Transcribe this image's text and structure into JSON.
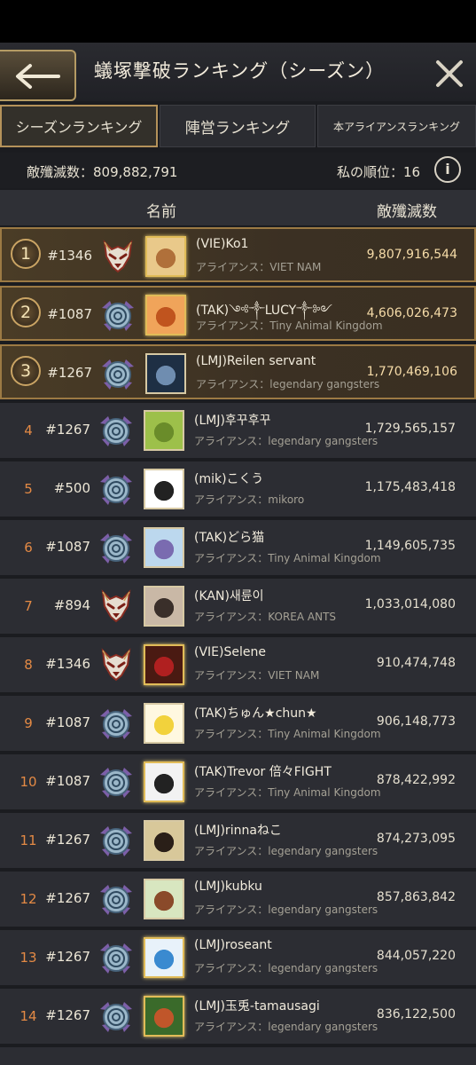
{
  "header": {
    "title": "蟻塚撃破ランキング（シーズン）"
  },
  "tabs": [
    {
      "label": "シーズンランキング",
      "active": true
    },
    {
      "label": "陣営ランキング",
      "active": false
    },
    {
      "label": "本アライアンスランキング",
      "active": false
    }
  ],
  "stats": {
    "kills_label": "敵殲滅数：",
    "kills_value": "809,882,791",
    "my_rank_label": "私の順位：",
    "my_rank_value": "16"
  },
  "columns": {
    "name": "名前",
    "score": "敵殲滅数"
  },
  "alliance_prefix": "アライアンス：",
  "rows": [
    {
      "rank": "1",
      "server": "#1346",
      "emblem": "fox",
      "name": "(VIE)Ko1",
      "alliance": "VIET NAM",
      "score": "9,807,916,544",
      "avatar_color": "#b0703a",
      "avatar_bg": "#e9c98a"
    },
    {
      "rank": "2",
      "server": "#1087",
      "emblem": "ribbon",
      "name": "(TAK)༺༒LUCY༒༻",
      "alliance": "Tiny Animal Kingdom",
      "score": "4,606,026,473",
      "avatar_color": "#c0541e",
      "avatar_bg": "#f0a45a"
    },
    {
      "rank": "3",
      "server": "#1267",
      "emblem": "ribbon",
      "name": "(LMJ)Reilen servant",
      "alliance": "legendary gangsters",
      "score": "1,770,469,106",
      "avatar_color": "#6f8db0",
      "avatar_bg": "#1e2f44"
    },
    {
      "rank": "4",
      "server": "#1267",
      "emblem": "ribbon",
      "name": "(LMJ)후꾸후꾸",
      "alliance": "legendary gangsters",
      "score": "1,729,565,157",
      "avatar_color": "#6a8c2a",
      "avatar_bg": "#9dc04a"
    },
    {
      "rank": "5",
      "server": "#500",
      "emblem": "ribbon",
      "name": "(mik)こくう",
      "alliance": "mikoro",
      "score": "1,175,483,418",
      "avatar_color": "#222222",
      "avatar_bg": "#ffffff"
    },
    {
      "rank": "6",
      "server": "#1087",
      "emblem": "ribbon",
      "name": "(TAK)どら猫",
      "alliance": "Tiny Animal Kingdom",
      "score": "1,149,605,735",
      "avatar_color": "#7a6bb0",
      "avatar_bg": "#bcd8ee"
    },
    {
      "rank": "7",
      "server": "#894",
      "emblem": "fox",
      "name": "(KAN)새륜이",
      "alliance": "KOREA ANTS",
      "score": "1,033,014,080",
      "avatar_color": "#3a2f2a",
      "avatar_bg": "#c9b8a6"
    },
    {
      "rank": "8",
      "server": "#1346",
      "emblem": "fox",
      "name": "(VIE)Selene",
      "alliance": "VIET NAM",
      "score": "910,474,748",
      "avatar_color": "#b02020",
      "avatar_bg": "#4a1a12"
    },
    {
      "rank": "9",
      "server": "#1087",
      "emblem": "ribbon",
      "name": "(TAK)ちゅん★chun★",
      "alliance": "Tiny Animal Kingdom",
      "score": "906,148,773",
      "avatar_color": "#f2d23c",
      "avatar_bg": "#fff8e0"
    },
    {
      "rank": "10",
      "server": "#1087",
      "emblem": "ribbon",
      "name": "(TAK)Trevor 倍々FIGHT",
      "alliance": "Tiny Animal Kingdom",
      "score": "878,422,992",
      "avatar_color": "#222222",
      "avatar_bg": "#f2f2f2"
    },
    {
      "rank": "11",
      "server": "#1267",
      "emblem": "ribbon",
      "name": "(LMJ)rinnaねこ",
      "alliance": "legendary gangsters",
      "score": "874,273,095",
      "avatar_color": "#2a1f18",
      "avatar_bg": "#d8c89a"
    },
    {
      "rank": "12",
      "server": "#1267",
      "emblem": "ribbon",
      "name": "(LMJ)kubku",
      "alliance": "legendary gangsters",
      "score": "857,863,842",
      "avatar_color": "#8a4a2a",
      "avatar_bg": "#d8e6c0"
    },
    {
      "rank": "13",
      "server": "#1267",
      "emblem": "ribbon",
      "name": "(LMJ)roseant",
      "alliance": "legendary gangsters",
      "score": "844,057,220",
      "avatar_color": "#3a8ad0",
      "avatar_bg": "#e8f2fa"
    },
    {
      "rank": "14",
      "server": "#1267",
      "emblem": "ribbon",
      "name": "(LMJ)玉兎-tamausagi",
      "alliance": "legendary gangsters",
      "score": "836,122,500",
      "avatar_color": "#c0562a",
      "avatar_bg": "#3a6a2a"
    }
  ]
}
